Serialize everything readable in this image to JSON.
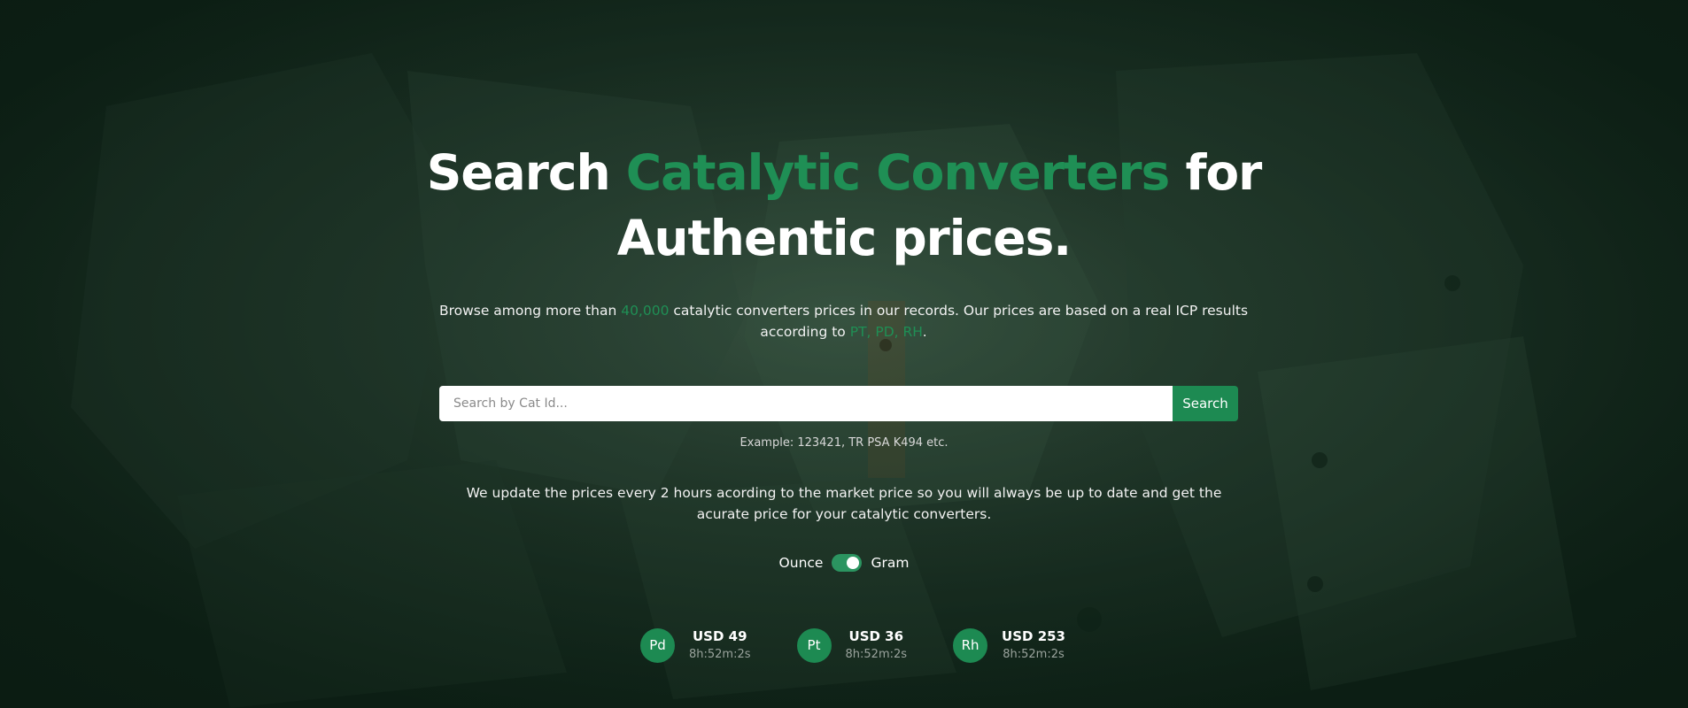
{
  "hero": {
    "headline": {
      "part1": "Search ",
      "accent": "Catalytic Converters",
      "part2": " for",
      "line2": "Authentic prices."
    },
    "intro": {
      "before_count": "Browse among more than ",
      "count": "40,000",
      "middle": " catalytic converters prices in our records. Our prices are based on a real ICP results according to ",
      "metals": "PT, PD, RH",
      "end": "."
    },
    "colors": {
      "accent": "#1f8f55",
      "button": "#1d8a52",
      "background": "#0f2418"
    }
  },
  "search": {
    "placeholder": "Search by Cat Id...",
    "value": "",
    "button_label": "Search",
    "example": "Example: 123421, TR PSA K494 etc."
  },
  "update_note": "We update the prices every 2 hours acording to the market price so you will always be up to date and get the acurate price for your catalytic converters.",
  "unit_toggle": {
    "left_label": "Ounce",
    "right_label": "Gram",
    "selected": "Gram"
  },
  "metals": [
    {
      "symbol": "Pd",
      "price": "USD 49",
      "time": "8h:52m:2s"
    },
    {
      "symbol": "Pt",
      "price": "USD 36",
      "time": "8h:52m:2s"
    },
    {
      "symbol": "Rh",
      "price": "USD 253",
      "time": "8h:52m:2s"
    }
  ]
}
